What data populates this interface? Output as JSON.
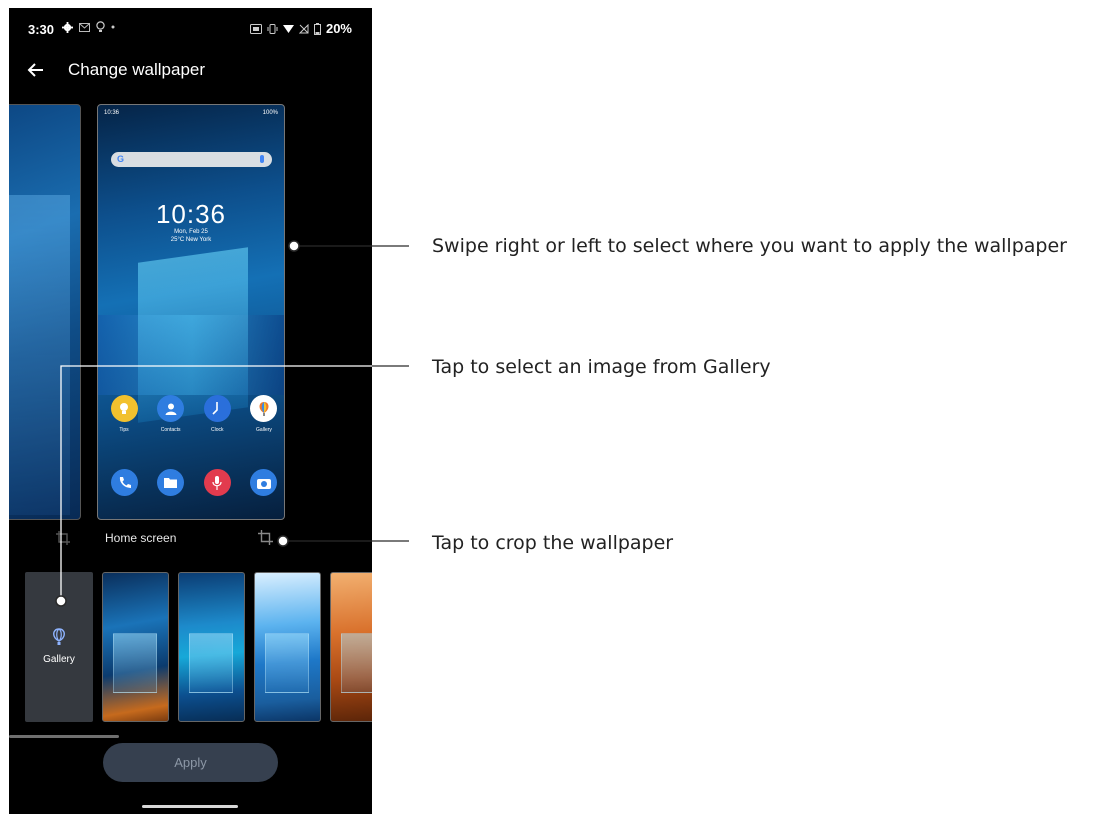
{
  "status_bar": {
    "time": "3:30",
    "battery": "20%",
    "left_icons": [
      "gear-icon",
      "mail-icon",
      "bulb-icon",
      "dot-icon"
    ],
    "right_icons": [
      "sim-icon",
      "vibrate-icon",
      "wifi-icon",
      "no-signal-icon",
      "battery-icon"
    ]
  },
  "app_bar": {
    "title": "Change wallpaper",
    "back_icon": "arrow-left-icon"
  },
  "preview": {
    "label": "Home screen",
    "mini_status_time": "10:36",
    "mini_status_battery": "100%",
    "search_logo": "G",
    "clock": "10:36",
    "date": "Mon, Feb 25",
    "weather": "25°C  New York",
    "apps_row1": [
      {
        "label": "Tips",
        "color": "#f2c12e",
        "icon": "bulb-icon"
      },
      {
        "label": "Contacts",
        "color": "#2f7de0",
        "icon": "person-icon"
      },
      {
        "label": "Clock",
        "color": "#2a6fdb",
        "icon": "clock-icon"
      },
      {
        "label": "Gallery",
        "color": "#ffffff",
        "icon": "balloon-icon"
      }
    ],
    "apps_row2": [
      {
        "label": "",
        "color": "#2f7de0",
        "icon": "phone-icon"
      },
      {
        "label": "",
        "color": "#2f7de0",
        "icon": "folder-icon"
      },
      {
        "label": "",
        "color": "#e23b4e",
        "icon": "mic-icon"
      },
      {
        "label": "",
        "color": "#2f7de0",
        "icon": "camera-icon"
      }
    ]
  },
  "thumbnails": {
    "gallery_label": "Gallery"
  },
  "apply_label": "Apply",
  "callouts": {
    "swipe": "Swipe right or left to select where you want to apply the wallpaper",
    "gallery": "Tap to select an image from Gallery",
    "crop": "Tap to crop the wallpaper"
  },
  "colors": {
    "phone_bg": "#000000",
    "apply_bg": "#36404f",
    "gallery_tile_bg": "#35393f",
    "callout_line": "#2a2a2a"
  }
}
